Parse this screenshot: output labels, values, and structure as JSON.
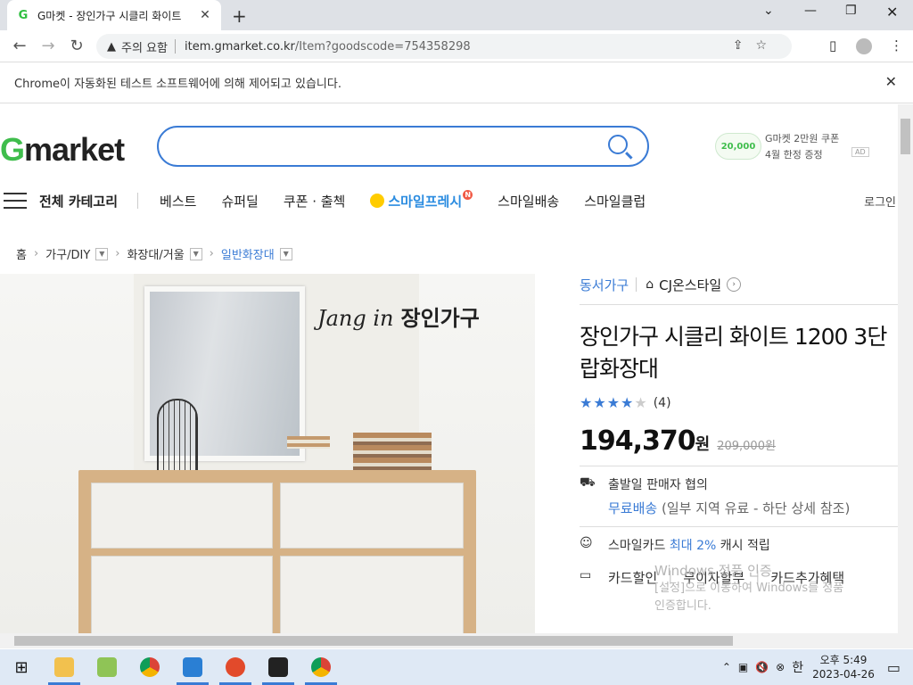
{
  "browser": {
    "tab_title": "G마켓 - 장인가구 시클리 화이트",
    "tab_favicon": "G",
    "security_label": "주의 요함",
    "url_host": "item.gmarket.co.kr",
    "url_path": "/Item?goodscode=754358298"
  },
  "infobar": {
    "message": "Chrome이 자동화된 테스트 소프트웨어에 의해 제어되고 있습니다."
  },
  "header": {
    "logo_g": "G",
    "logo_rest": "market",
    "search_placeholder": "",
    "ad_coin": "20,000",
    "ad_line1": "G마켓 2만원 쿠폰",
    "ad_line2": "4월 한정 증정",
    "ad_tag": "AD"
  },
  "gnb": {
    "all_category": "전체 카테고리",
    "items": [
      "베스트",
      "슈퍼딜",
      "쿠폰 · 출첵"
    ],
    "smile_fresh": "스마일프레시",
    "smile_new": "N",
    "items2": [
      "스마일배송",
      "스마일클럽"
    ],
    "login": "로그인"
  },
  "breadcrumb": {
    "items": [
      "홈",
      "가구/DIY",
      "화장대/거울",
      "일반화장대"
    ]
  },
  "product": {
    "image_brand_script": "Jang in",
    "image_brand": "장인가구",
    "shop_name": "동서가구",
    "store_name": "CJ온스타일",
    "title_line1": "장인가구 시클리 화이트 1200 3단",
    "title_line2": "랍화장대",
    "rating_stars": 4,
    "review_count": "(4)",
    "price": "194,370",
    "price_unit": "원",
    "original_price": "209,000원",
    "ship_label": "출발일 판매자 협의",
    "free_ship": "무료배송",
    "free_ship_note": "(일부 지역 유료 - 하단 상세 참조)",
    "card_text_a": "스마일카드",
    "card_text_b": "최대 2%",
    "card_text_c": "캐시 적립",
    "benefit1": "카드할인",
    "benefit2": "무이자할부",
    "benefit3": "카드추가혜택"
  },
  "watermark": {
    "line1": "Windows 정품 인증",
    "line2": "[설정]으로 이동하여 Windows를 정품",
    "line3": "인증합니다."
  },
  "taskbar": {
    "time": "오후 5:49",
    "date": "2023-04-26",
    "ime": "한"
  },
  "colors": {
    "accent": "#3a7bd5",
    "gmarket_green": "#3fbd4c"
  }
}
